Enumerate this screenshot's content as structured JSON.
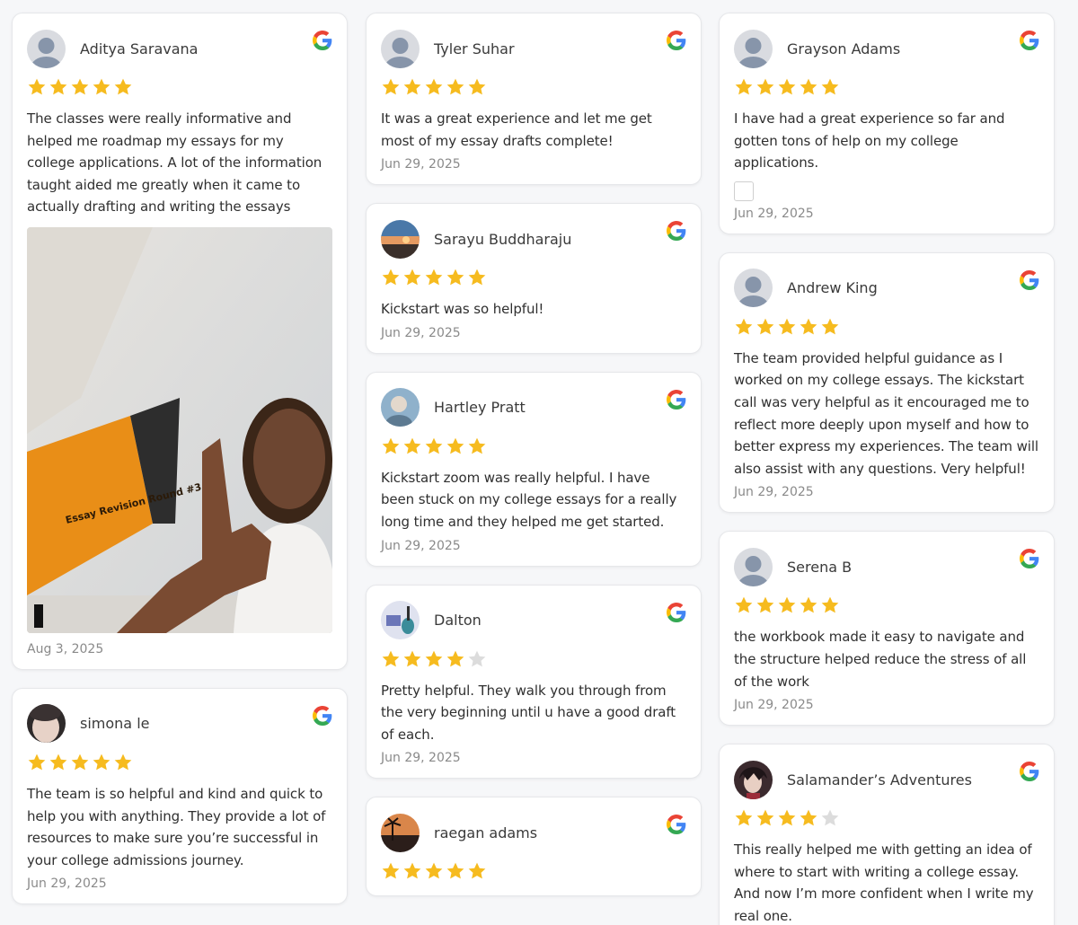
{
  "colors": {
    "star_filled": "#f6bb1f",
    "star_empty": "#dcdcdc",
    "google_blue": "#4285F4",
    "google_red": "#EA4335",
    "google_yellow": "#FBBC05",
    "google_green": "#34A853"
  },
  "reviews": [
    {
      "name": "Aditya Saravana",
      "rating": 5,
      "text": "The classes were really informative and helped me roadmap my essays for my college applications. A lot of the information taught aided me greatly when it came to actually drafting and writing the essays",
      "date": "Aug 3, 2025",
      "avatar": "default-avatar",
      "photo_sign": "Essay Revision Round #3"
    },
    {
      "name": "simona le",
      "rating": 5,
      "text": "The team is so helpful and kind and quick to help you with anything. They provide a lot of resources to make sure you’re successful in your college admissions journey.",
      "date": "Jun 29, 2025",
      "avatar": "photo-avatar"
    },
    {
      "name": "Tyler Suhar",
      "rating": 5,
      "text": "It was a great experience and let me get most of my essay drafts complete!",
      "date": "Jun 29, 2025",
      "avatar": "default-avatar"
    },
    {
      "name": "Sarayu Buddharaju",
      "rating": 5,
      "text": "Kickstart was so helpful!",
      "date": "Jun 29, 2025",
      "avatar": "sunset-avatar"
    },
    {
      "name": "Hartley Pratt",
      "rating": 5,
      "text": "Kickstart zoom was really helpful. I have been stuck on my college essays for a really long time and they helped me get started.",
      "date": "Jun 29, 2025",
      "avatar": "photo-avatar"
    },
    {
      "name": "Dalton",
      "rating": 4,
      "text": "Pretty helpful. They walk you through from the very beginning until u have a good draft of each.",
      "date": "Jun 29, 2025",
      "avatar": "guitar-avatar"
    },
    {
      "name": "raegan adams",
      "rating": 5,
      "text": "",
      "date": "",
      "avatar": "palm-sunset-avatar"
    },
    {
      "name": "Grayson Adams",
      "rating": 5,
      "text": "I have had a great experience so far and gotten tons of help on my college applications.",
      "date": "Jun 29, 2025",
      "avatar": "default-avatar"
    },
    {
      "name": "Andrew King",
      "rating": 5,
      "text": "The team provided helpful guidance as I worked on my college essays. The kickstart call was very helpful as it encouraged me to reflect more deeply upon myself and how to better express my experiences. The team will also assist with any questions. Very helpful!",
      "date": "Jun 29, 2025",
      "avatar": "default-avatar"
    },
    {
      "name": "Serena B",
      "rating": 5,
      "text": "the workbook made it easy to navigate and the structure helped reduce the stress of all of the work",
      "date": "Jun 29, 2025",
      "avatar": "default-avatar"
    },
    {
      "name": "Salamander’s Adventures",
      "rating": 4,
      "text": "This really helped me with getting an idea of where to start with writing a college essay. And now I’m more confident when I write my real one.",
      "date": "",
      "avatar": "anime-avatar"
    }
  ]
}
